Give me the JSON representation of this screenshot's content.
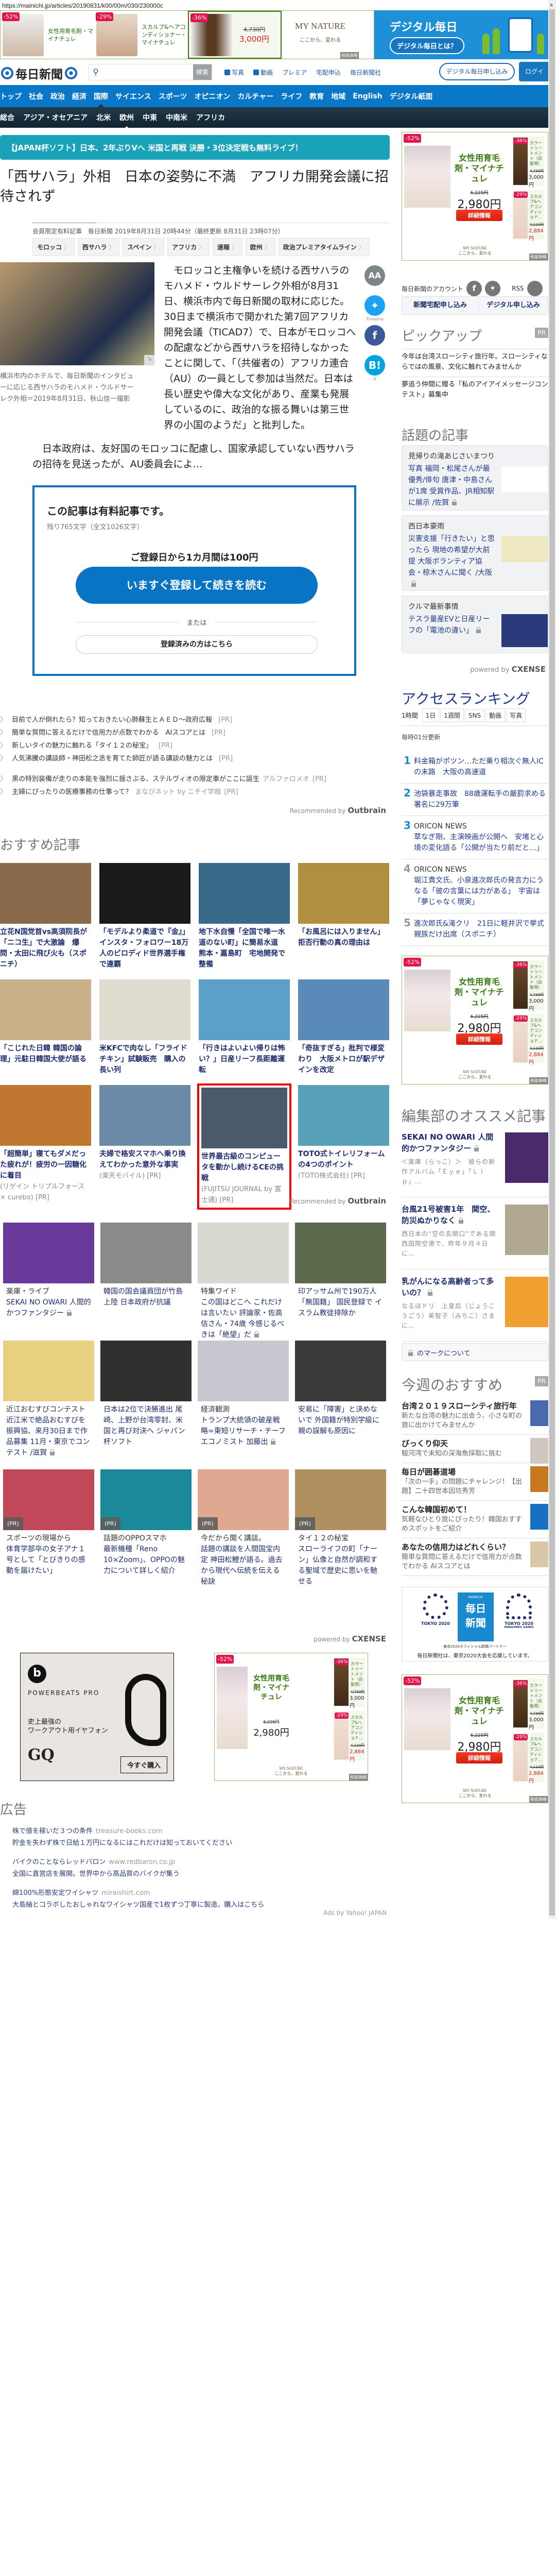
{
  "url": "https://mainichi.jp/articles/20190831/k00/00m/030/230000c",
  "top_ad": {
    "items": [
      {
        "badge": "-52%",
        "name": "女性用育毛剤・マイナチュレ"
      },
      {
        "badge": "-29%",
        "name": "スカルプ&ヘアコンディショナー・マイナチュレ"
      }
    ],
    "featured": {
      "badge": "-36%",
      "old_price": "4,730円",
      "price": "3,000円"
    },
    "brand": "MY NATURE",
    "tagline": "ここから、変わる",
    "tax": "税抜価格"
  },
  "digital_banner": {
    "title": "デジタル毎日",
    "button": "デジタル毎日とは？"
  },
  "header": {
    "logo": "毎日新聞",
    "search_button": "検索",
    "links": [
      "写真",
      "動画",
      "プレミア",
      "宅配申込",
      "毎日新聞社"
    ],
    "subscribe": "デジタル毎日申し込み",
    "login": "ログイン"
  },
  "nav": [
    "トップ",
    "社会",
    "政治",
    "経済",
    "国際",
    "サイエンス",
    "スポーツ",
    "オピニオン",
    "カルチャー",
    "ライフ",
    "教育",
    "地域",
    "English",
    "デジタル紙面"
  ],
  "nav_active": "国際",
  "subnav": [
    "総合",
    "アジア・オセアニア",
    "北米",
    "欧州",
    "中東",
    "中南米",
    "アフリカ"
  ],
  "subnav_active": "欧州",
  "promo": "【JAPAN杯ソフト】日本、2年ぶりVへ 米国と再戦 決勝・3位決定戦も無料ライブ！",
  "article": {
    "title": "「西サハラ」外相　日本の姿勢に不満　アフリカ開発会議に招待されず",
    "meta": "会員限定有料記事　毎日新聞 2019年8月31日 20時44分（最終更新 8月31日 23時07分）",
    "tags": [
      "モロッコ",
      "西サハラ",
      "スペイン",
      "アフリカ",
      "速報",
      "欧州",
      "政治プレミアタイムライン"
    ],
    "caption": "横浜市内のホテルで、毎日新聞のインタビューに応じる西サハラのモハメド・ウルドサーレク外相＝2019年8月31日、秋山信一撮影",
    "body1": "モロッコと主権争いを続ける西サハラのモハメド・ウルドサーレク外相が8月31日、横浜市内で毎日新聞の取材に応じた。30日まで横浜市で開かれた第7回アフリカ開発会議（TICAD7）で、日本がモロッコへの配慮などから西サハラを招待しなかったことに関して、「（共催者の）アフリカ連合（AU）の一員として参加は当然だ。日本は長い歴史や偉大な文化があり、産業も発展しているのに、政治的な振る舞いは第三世界の小国のようだ」と批判した。",
    "body2": "日本政府は、友好国のモロッコに配慮し、国家承認していない西サハラの招待を見送ったが、AU委員会によ…"
  },
  "social": {
    "font_label": "AA",
    "timeline": "Timeline",
    "hatena": "B!",
    "hatena_count": "0"
  },
  "paywall": {
    "heading": "この記事は有料記事です。",
    "remaining": "残り765文字（全文1026文字）",
    "price": "ご登録日から1カ月間は100円",
    "cta": "いますぐ登録して続きを読む",
    "or": "または",
    "login": "登録済みの方はこちら"
  },
  "pr_links": [
    {
      "text": "目前で人が倒れたら？知っておきたい心肺蘇生とＡＥＤ～政府広報",
      "source": "",
      "pr": "[PR]"
    },
    {
      "text": "簡単な質問に答えるだけで信用力が点数でわかる　AIスコアとは",
      "source": "",
      "pr": "[PR]"
    },
    {
      "text": "新しいタイの魅力に触れる「タイ１２の秘宝」",
      "source": "",
      "pr": "[PR]"
    },
    {
      "text": "人気沸騰の講談師・神田松之丞を育てた師匠が語る講談の魅力とは",
      "source": "",
      "pr": "[PR]"
    },
    {
      "text": "黒の特別装備が走りの本能を強烈に揺さぶる、ステルヴィオの限定車がここに誕生",
      "source": "アルファロメオ",
      "pr": "[PR]"
    },
    {
      "text": "主婦にぴったりの医療事務の仕事って？",
      "source": "まなびネット by ニチイ学館",
      "pr": "[PR]"
    }
  ],
  "outbrain": {
    "label": "Recommended by",
    "brand": "Outbrain"
  },
  "recommended": {
    "heading": "おすすめ記事",
    "items": [
      {
        "title": "立花N国党首vs高須院長が「ニコ生」で大激論　爆問・太田に飛び火も（スポニチ）",
        "source": ""
      },
      {
        "title": "「モデルより柔道で『金』」インスタ・フォロワー18万人のビロディド世界選手権で連覇",
        "source": ""
      },
      {
        "title": "地下水自慢「全国で唯一水道のない町」に簡易水道　熊本・嘉島町　宅地開発で整備",
        "source": ""
      },
      {
        "title": "「お風呂には入りません」拒否行動の真の理由は",
        "source": ""
      },
      {
        "title": "「こじれた日韓 韓国の論理」元駐日韓国大使が語る",
        "source": ""
      },
      {
        "title": "米KFCで肉なし「フライドチキン」試験販売　購入の長い列",
        "source": ""
      },
      {
        "title": "「行きはよいよい帰りは怖い？」日産リーフ長距離運転",
        "source": ""
      },
      {
        "title": "「奇抜すぎる」批判で様変わり　大阪メトロが駅デザインを改定",
        "source": ""
      },
      {
        "title": "「超簡単」寝てもダメだった疲れが！疲労の一因糖化に着目",
        "source": "(リゲイン トリプルフォース × curebo) [PR]"
      },
      {
        "title": "夫婦で格安スマホへ乗り換えてわかった意外な事実",
        "source": "(楽天モバイル) [PR]"
      },
      {
        "title": "世界最古級のコンピュータを動かし続けるCEの挑戦",
        "source": "(FUJITSU JOURNAL by 富士通) [PR]",
        "highlight": true
      },
      {
        "title": "TOTO式トイレリフォームの4つのポイント",
        "source": "(TOTO株式会社) [PR]"
      }
    ]
  },
  "cx_grid": {
    "items": [
      {
        "label": "楽庫・ライブ",
        "title": "SEKAI NO OWARI 人間的かつファンタジー",
        "lock": true
      },
      {
        "label": "",
        "title": "韓国の国会議員団が竹島上陸 日本政府が抗議"
      },
      {
        "label": "特集ワイド",
        "title": "この国はどこへ これだけは言いたい 評論家・佐高信さん・74歳 今感じるべきは「絶望」だ",
        "lock": true
      },
      {
        "label": "",
        "title": "印アッサム州で190万人「無国籍」 国民登録で イスラム教徒排除か"
      },
      {
        "label": "近江おむすびコンテスト",
        "title": "近江米で絶品おむすびを 振興協、来月30日まで作品募集 11月・東京でコンテスト /滋賀",
        "lock": true
      },
      {
        "label": "",
        "title": "日本は2位で決勝進出 尾崎、上野が台湾零封、米国と再び対決へ ジャパン杯ソフト"
      },
      {
        "label": "経済観測",
        "title": "トランプ大統領の破産戦略=東短リサーチ・チーフエコノミスト 加藤出",
        "lock": true
      },
      {
        "label": "",
        "title": "安易に「障害」と決めないで 外国籍が特別学級に 親の誤解も原因に"
      },
      {
        "label": "スポーツの現場から",
        "title": "体育学部卒の女子アナ１号として「とびきりの感動を届けたい」",
        "pr": "(PR)"
      },
      {
        "label": "話題のOPPOスマホ",
        "title": "最新機種「Reno 10×Zoom」、OPPOの魅力について詳しく紹介",
        "pr": "(PR)"
      },
      {
        "label": "今だから聞く講談。",
        "title": "話題の講談を人間国宝内定 神田松鯉が語る。過去から現代へ伝統を伝える秘訣",
        "pr": "(PR)"
      },
      {
        "label": "タイ１２の秘宝",
        "title": "スローライフの町「ナーン」仏像と自然が調和する聖域で歴史に思いを馳せる",
        "pr": "(PR)"
      }
    ],
    "powered": "powered by",
    "brand": "CXENSE"
  },
  "beats_ad": {
    "logo": "b",
    "product": "POWERBEATS PRO",
    "copy1": "史上最強の",
    "copy2": "ワークアウト用イヤフォン",
    "media": "GQ",
    "button": "今すぐ購入"
  },
  "mn_ad": {
    "main": {
      "badge": "-52%",
      "name": "女性用育毛剤・マイナチュレ",
      "old": "6,225円",
      "price": "2,980円"
    },
    "side": [
      {
        "badge": "-36%",
        "name": "カラートリートメント（白髪用）",
        "old": "4,730円",
        "price": "3,000円"
      },
      {
        "badge": "-29%",
        "name": "スカルプ&ヘアコンディショナ…",
        "old": "4,110円",
        "price": "2,884円"
      }
    ],
    "detail": "詳細情報"
  },
  "ads": {
    "heading": "広告",
    "items": [
      {
        "title": "株で億を稼いだ３つの条件",
        "url": "treasure-books.com",
        "desc": "貯金を失わず株で日給１万円になるにはこれだけは知っておいてください"
      },
      {
        "title": "バイクのことならレッドバロン",
        "url": "www.redbaron.co.jp",
        "desc": "全国に直営店を展開。世界中から高品質のバイクが集う"
      },
      {
        "title": "綿100%形態安定ワイシャツ",
        "url": "miraishirt.com",
        "desc": "大島紬とコラボしたおしゃれなワイシャツ国産で1枚ずつ丁寧に製造。購入はこちら"
      }
    ],
    "provider": "Ads by Yahoo! JAPAN"
  },
  "sidebar": {
    "account_label": "毎日新聞のアカウント",
    "rss": "RSS",
    "delivery": "新聞宅配申し込み",
    "digital": "デジタル申し込み",
    "pickup": {
      "heading": "ピックアップ",
      "pr": "PR",
      "items": [
        "今年は台湾スローシティ旅行年。スローシティならではの風景、文化に触れてみませんか",
        "夢追う仲間に贈る「私のアイアイメッセージコンテスト」募集中"
      ]
    },
    "topics": {
      "heading": "話題の記事",
      "items": [
        {
          "category": "見帰りの滝あじさいまつり",
          "title": "写真 福岡・松尾さんが最優秀/俳句 唐津・中島さんが1席 受賞作品、JR相知駅に展示 /佐賀"
        },
        {
          "category": "西日本豪雨",
          "title": "災害支援「行きたい」と思ったら 現地の希望が大前提 大阪ボランティア協会・椋木さんに聞く /大阪"
        },
        {
          "category": "クルマ最新事情",
          "title": "テスラ量産EVと日産リーフの「電池の違い」"
        }
      ],
      "powered": "powered by",
      "brand": "CXENSE"
    },
    "ranking": {
      "heading": "アクセスランキング",
      "tabs": [
        "1時間",
        "1日",
        "1週間",
        "SNS",
        "動画",
        "写真"
      ],
      "updated": "毎時01分更新",
      "items": [
        {
          "n": "1",
          "source": "",
          "title": "料金箱がポツン…ただ乗り相次ぐ無人ICの末路　大阪の高速道"
        },
        {
          "n": "2",
          "source": "",
          "title": "池袋暴走事故　88歳運転手の厳罰求める署名に29万筆"
        },
        {
          "n": "3",
          "source": "ORICON NEWS",
          "title": "草なぎ剛、主演映画が公開へ　安堵と心境の変化語る「公開が当たり前だと…」"
        },
        {
          "n": "4",
          "source": "ORICON NEWS",
          "title": "堀江貴文氏、小泉進次郎氏の発言力にうなる「彼の言葉には力がある」　宇宙は「夢じゃなく現実」"
        },
        {
          "n": "5",
          "source": "",
          "title": "進次郎氏&滝クリ　21日に軽井沢で挙式 親族だけ出席（スポニチ）"
        }
      ]
    },
    "editors": {
      "heading": "編集部のオススメ記事",
      "items": [
        {
          "title": "SEKAI NO OWARI 人間的かつファンタジー",
          "excerpt": "＜楽庫（らっこ）＞　彼らの新作アルバム「Ｅｙｅ」「Ｌｉｐ」…"
        },
        {
          "title": "台風21号被害1年　関空、防災ぬかりなく",
          "excerpt": "西日本の“空の玄関口”である関西国際空港で、昨年９月４日に…"
        },
        {
          "title": "乳がんになる高齢者って多いの？",
          "excerpt": "なるほドリ　上皇后（じょうこうごう）美智子（みちこ）さまに…"
        }
      ],
      "lock_note": "のマークについて"
    },
    "weekly": {
      "heading": "今週のおすすめ",
      "pr": "PR",
      "items": [
        {
          "title": "台湾２０１９スローシティ旅行年",
          "desc": "新たな台湾の魅力に出会う、小さな町の旅に出かけてみませんか"
        },
        {
          "title": "びっくり仰天",
          "desc": "駿河湾で未知の深海魚採取に挑む"
        },
        {
          "title": "毎日が囲碁道場",
          "desc": "「次の一手」の問題にチャレンジ！【出題】二十四世本因坊秀芳"
        },
        {
          "title": "こんな韓国初めて！",
          "desc": "気軽なひとり旅にぴったり！韓国おすすめスポットをご紹介"
        },
        {
          "title": "あなたの信用力はどれくらい？",
          "desc": "簡単な質問に答えるだけで信用力が点数でわかる AIスコアとは"
        }
      ]
    },
    "tokyo": {
      "left": "TOKYO 2020",
      "center_top": "MAINICHI",
      "center": "毎日新聞",
      "right": "TOKYO 2020",
      "right_sub": "PARALYMPIC GAMES",
      "partner": "東京2020オフィシャル新聞パートナー",
      "support": "毎日新聞社は、東京2020大会を応援しています。"
    }
  },
  "colors": {
    "nav": "#0a78c8",
    "promo": "#1aa2b8",
    "paywall": "#0a72c0",
    "link": "#1d2d6e",
    "badge": "#e0134c"
  }
}
